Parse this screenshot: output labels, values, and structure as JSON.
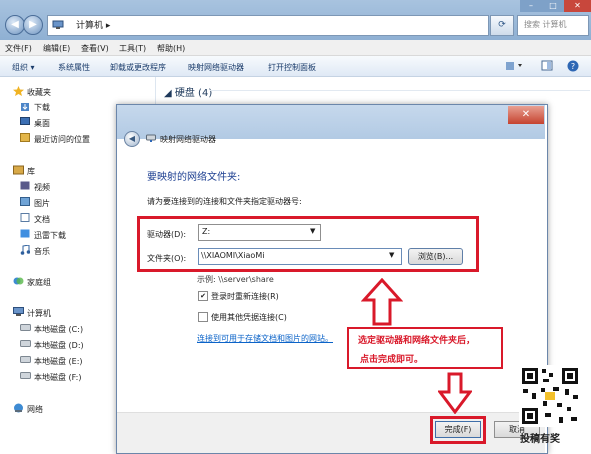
{
  "window": {
    "breadcrumb": "计算机",
    "search_placeholder": "搜索 计算机",
    "controls": {
      "minimize": "–",
      "maximize": "□",
      "close": "✕"
    }
  },
  "menu": [
    "文件(F)",
    "编辑(E)",
    "查看(V)",
    "工具(T)",
    "帮助(H)"
  ],
  "toolbar": {
    "items": [
      "组织 ▾",
      "系统属性",
      "卸载或更改程序",
      "映射网络驱动器",
      "打开控制面板"
    ],
    "right_icons": [
      "view-options-icon",
      "preview-pane-icon",
      "help-icon"
    ]
  },
  "nav": {
    "favorites": {
      "header": "收藏夹",
      "items": [
        "下载",
        "桌面",
        "最近访问的位置"
      ]
    },
    "libraries": {
      "header": "库",
      "items": [
        "视频",
        "图片",
        "文档",
        "迅雷下载",
        "音乐"
      ]
    },
    "homegroup": "家庭组",
    "computer": {
      "header": "计算机",
      "items": [
        "本地磁盘 (C:)",
        "本地磁盘 (D:)",
        "本地磁盘 (E:)",
        "本地磁盘 (F:)"
      ]
    },
    "network": "网络"
  },
  "main": {
    "drives_header": "硬盘 (4)"
  },
  "dialog": {
    "title": "映射网络驱动器",
    "close_glyph": "✕",
    "heading": "要映射的网络文件夹:",
    "description": "请为要连接到的连接和文件夹指定驱动器号:",
    "drive_label": "驱动器(D):",
    "drive_value": "Z:",
    "folder_label": "文件夹(O):",
    "folder_value": "\\\\XIAOMI\\XiaoMi",
    "browse_label": "浏览(B)...",
    "example": "示例: \\\\server\\share",
    "reconnect_label": "登录时重新连接(R)",
    "reconnect_checked": true,
    "credentials_label": "使用其他凭据连接(C)",
    "credentials_checked": false,
    "link": "连接到可用于存储文档和图片的网站。",
    "finish_label": "完成(F)",
    "cancel_label": "取消"
  },
  "annotation": {
    "line1": "选定驱动器和网络文件夹后，",
    "line2": "点击完成即可。",
    "color": "#d9192a"
  },
  "watermark": {
    "text": "投稿有奖"
  },
  "colors": {
    "accent_red": "#d9192a",
    "link_blue": "#0b63c8",
    "heading_blue": "#1d3f91"
  }
}
